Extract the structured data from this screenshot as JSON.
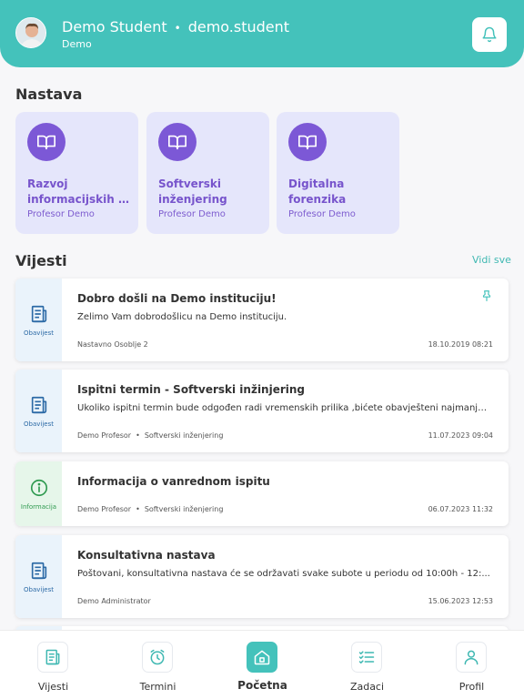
{
  "colors": {
    "accent": "#44c2bb",
    "course_card_bg": "#e5e6fb",
    "course_purple": "#7c58d6",
    "notice_blue": "#2c6aa6",
    "info_green": "#2f9a50"
  },
  "header": {
    "user_name": "Demo Student",
    "username": "demo.student",
    "institution": "Demo",
    "notification_icon": "bell-icon"
  },
  "courses": {
    "title": "Nastava",
    "items": [
      {
        "line1": "Razvoj",
        "line2": "informacijskih s…",
        "professor": "Profesor Demo",
        "icon": "book-icon"
      },
      {
        "line1": "Softverski",
        "line2": "inženjering",
        "professor": "Profesor Demo",
        "icon": "book-icon"
      },
      {
        "line1": "Digitalna",
        "line2": "forenzika",
        "professor": "Profesor Demo",
        "icon": "book-icon"
      }
    ]
  },
  "news": {
    "title": "Vijesti",
    "see_all": "Vidi sve",
    "items": [
      {
        "type_label": "Obavijest",
        "title": "Dobro došli na Demo instituciju!",
        "body": "Želimo Vam dobrodošlicu na Demo instituciju.",
        "author": "Nastavno Osoblje 2",
        "course": "",
        "date": "18.10.2019 08:21",
        "pinned": true
      },
      {
        "type_label": "Obavijest",
        "title": "Ispitni termin - Softverski inžinjering",
        "body": "Ukoliko ispitni termin bude odgođen radi vremenskih prilika ,bićete obavješteni najmanje...",
        "author": "Demo Profesor",
        "course": "Softverski inženjering",
        "date": "11.07.2023 09:04"
      },
      {
        "type_label": "Informacija",
        "title": "Informacija o vanrednom ispitu",
        "body": "",
        "author": "Demo Profesor",
        "course": "Softverski inženjering",
        "date": "06.07.2023 11:32"
      },
      {
        "type_label": "Obavijest",
        "title": "Konsultativna nastava",
        "body": "Poštovani, konsultativna nastava će se održavati svake subote u periodu od 10:00h - 12:...",
        "author": "Demo Administrator",
        "course": "",
        "date": "15.06.2023 12:53"
      }
    ]
  },
  "bottom_nav": {
    "items": [
      {
        "label": "Vijesti",
        "icon": "newspaper-icon"
      },
      {
        "label": "Termini",
        "icon": "alarm-clock-icon"
      },
      {
        "label": "Početna",
        "icon": "home-icon",
        "active": true
      },
      {
        "label": "Zadaci",
        "icon": "checklist-icon"
      },
      {
        "label": "Profil",
        "icon": "user-icon"
      }
    ]
  }
}
